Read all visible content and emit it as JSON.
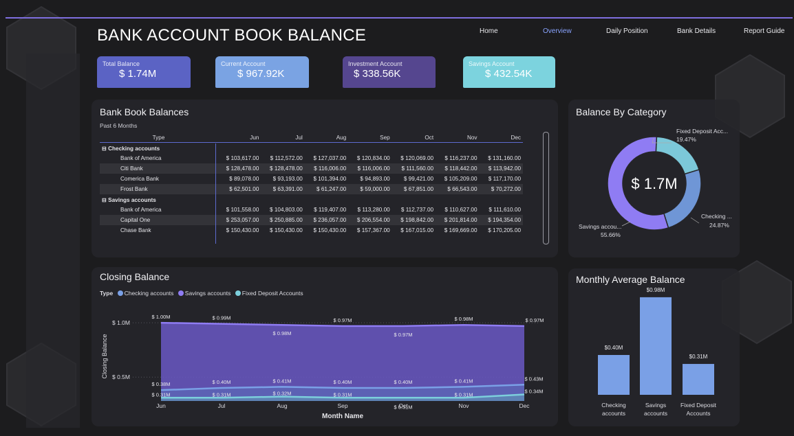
{
  "header": {
    "title": "BANK ACCOUNT BOOK BALANCE"
  },
  "nav": [
    {
      "label": "Home",
      "active": false
    },
    {
      "label": "Overview",
      "active": true
    },
    {
      "label": "Daily Position",
      "active": false
    },
    {
      "label": "Bank Details",
      "active": false
    },
    {
      "label": "Report Guide",
      "active": false
    }
  ],
  "kpis": [
    {
      "label": "Total Balance",
      "value": "$ 1.74M",
      "color": "#5b63c4"
    },
    {
      "label": "Current Account",
      "value": "$ 967.92K",
      "color": "#7aa3e3"
    },
    {
      "label": "Investment Account",
      "value": "$ 338.56K",
      "color": "#55468f"
    },
    {
      "label": "Savings Account",
      "value": "$ 432.54K",
      "color": "#7cd3de"
    }
  ],
  "bank_book": {
    "title": "Bank Book Balances",
    "subtitle": "Past 6 Months",
    "columns": [
      "Type",
      "Jun",
      "Jul",
      "Aug",
      "Sep",
      "Oct",
      "Nov",
      "Dec"
    ],
    "groups": [
      {
        "label": "Checking accounts",
        "rows": [
          {
            "name": "Bank of America",
            "values": [
              "$ 103,617.00",
              "$ 112,572.00",
              "$ 127,037.00",
              "$ 120,834.00",
              "$ 120,069.00",
              "$ 116,237.00",
              "$ 131,160.00"
            ]
          },
          {
            "name": "Citi Bank",
            "values": [
              "$ 128,478.00",
              "$ 128,478.00",
              "$ 116,006.00",
              "$ 116,006.00",
              "$ 111,560.00",
              "$ 118,442.00",
              "$ 113,942.00"
            ]
          },
          {
            "name": "Comerica Bank",
            "values": [
              "$ 89,078.00",
              "$ 93,193.00",
              "$ 101,394.00",
              "$ 94,893.00",
              "$ 99,421.00",
              "$ 105,209.00",
              "$ 117,170.00"
            ]
          },
          {
            "name": "Frost Bank",
            "values": [
              "$ 62,501.00",
              "$ 63,391.00",
              "$ 61,247.00",
              "$ 59,000.00",
              "$ 67,851.00",
              "$ 66,543.00",
              "$ 70,272.00"
            ]
          }
        ]
      },
      {
        "label": "Savings accounts",
        "rows": [
          {
            "name": "Bank of America",
            "values": [
              "$ 101,558.00",
              "$ 104,803.00",
              "$ 119,407.00",
              "$ 113,280.00",
              "$ 112,737.00",
              "$ 110,627.00",
              "$ 111,610.00"
            ]
          },
          {
            "name": "Capital One",
            "values": [
              "$ 253,057.00",
              "$ 250,885.00",
              "$ 236,057.00",
              "$ 206,554.00",
              "$ 198,842.00",
              "$ 201,814.00",
              "$ 194,354.00"
            ]
          },
          {
            "name": "Chase Bank",
            "values": [
              "$ 150,430.00",
              "$ 150,430.00",
              "$ 150,430.00",
              "$ 157,367.00",
              "$ 167,015.00",
              "$ 169,669.00",
              "$ 170,205.00"
            ]
          }
        ]
      }
    ]
  },
  "category": {
    "title": "Balance By Category",
    "center_label": "$ 1.7M",
    "slices": [
      {
        "name": "Fixed Deposit Acc...",
        "pct": "19.47%",
        "value": 19.47,
        "color": "#7cc8d9"
      },
      {
        "name": "Checking ...",
        "pct": "24.87%",
        "value": 24.87,
        "color": "#6f96d6"
      },
      {
        "name": "Savings accou...",
        "pct": "55.66%",
        "value": 55.66,
        "color": "#8f7cf3"
      }
    ]
  },
  "closing": {
    "title": "Closing Balance",
    "legend_title": "Type",
    "legend": [
      {
        "label": "Checking accounts",
        "color": "#7aa0e6"
      },
      {
        "label": "Savings accounts",
        "color": "#8f7cf3"
      },
      {
        "label": "Fixed Deposit Accounts",
        "color": "#7ccfdc"
      }
    ]
  },
  "monthly": {
    "title": "Monthly Average Balance"
  },
  "chart_data": [
    {
      "type": "area",
      "title": "Closing Balance",
      "xlabel": "Month Name",
      "ylabel": "Closing Balance",
      "x": [
        "Jun",
        "Jul",
        "Aug",
        "Sep",
        "Oct",
        "Nov",
        "Dec"
      ],
      "yticks": [
        "$ 0.5M",
        "$ 1.0M"
      ],
      "ylim": [
        0.28,
        1.07
      ],
      "series": [
        {
          "name": "Savings accounts",
          "color": "#8f7cf3",
          "values": [
            1.0,
            0.99,
            0.98,
            0.97,
            0.97,
            0.98,
            0.97
          ],
          "labels": [
            "$ 1.00M",
            "$ 0.99M",
            "$ 0.98M",
            "$ 0.97M",
            "$ 0.97M",
            "$ 0.98M",
            "$ 0.97M"
          ]
        },
        {
          "name": "Checking accounts",
          "color": "#7aa0e6",
          "values": [
            0.38,
            0.4,
            0.41,
            0.4,
            0.4,
            0.41,
            0.43
          ],
          "labels": [
            "$ 0.38M",
            "$ 0.40M",
            "$ 0.41M",
            "$ 0.40M",
            "$ 0.40M",
            "$ 0.41M",
            "$ 0.43M"
          ]
        },
        {
          "name": "Fixed Deposit Accounts",
          "color": "#7ccfdc",
          "values": [
            0.31,
            0.31,
            0.32,
            0.31,
            0.31,
            0.31,
            0.34
          ],
          "labels": [
            "$ 0.31M",
            "$ 0.31M",
            "$ 0.32M",
            "$ 0.31M",
            "$ 0.31M",
            "$ 0.31M",
            "$ 0.34M"
          ]
        }
      ]
    },
    {
      "type": "bar",
      "title": "Monthly Average Balance",
      "categories": [
        "Checking accounts",
        "Savings accounts",
        "Fixed Deposit Accounts"
      ],
      "values": [
        0.4,
        0.98,
        0.31
      ],
      "labels": [
        "$0.40M",
        "$0.98M",
        "$0.31M"
      ],
      "color": "#7aa0e6",
      "ylim": [
        0,
        1.0
      ]
    }
  ]
}
